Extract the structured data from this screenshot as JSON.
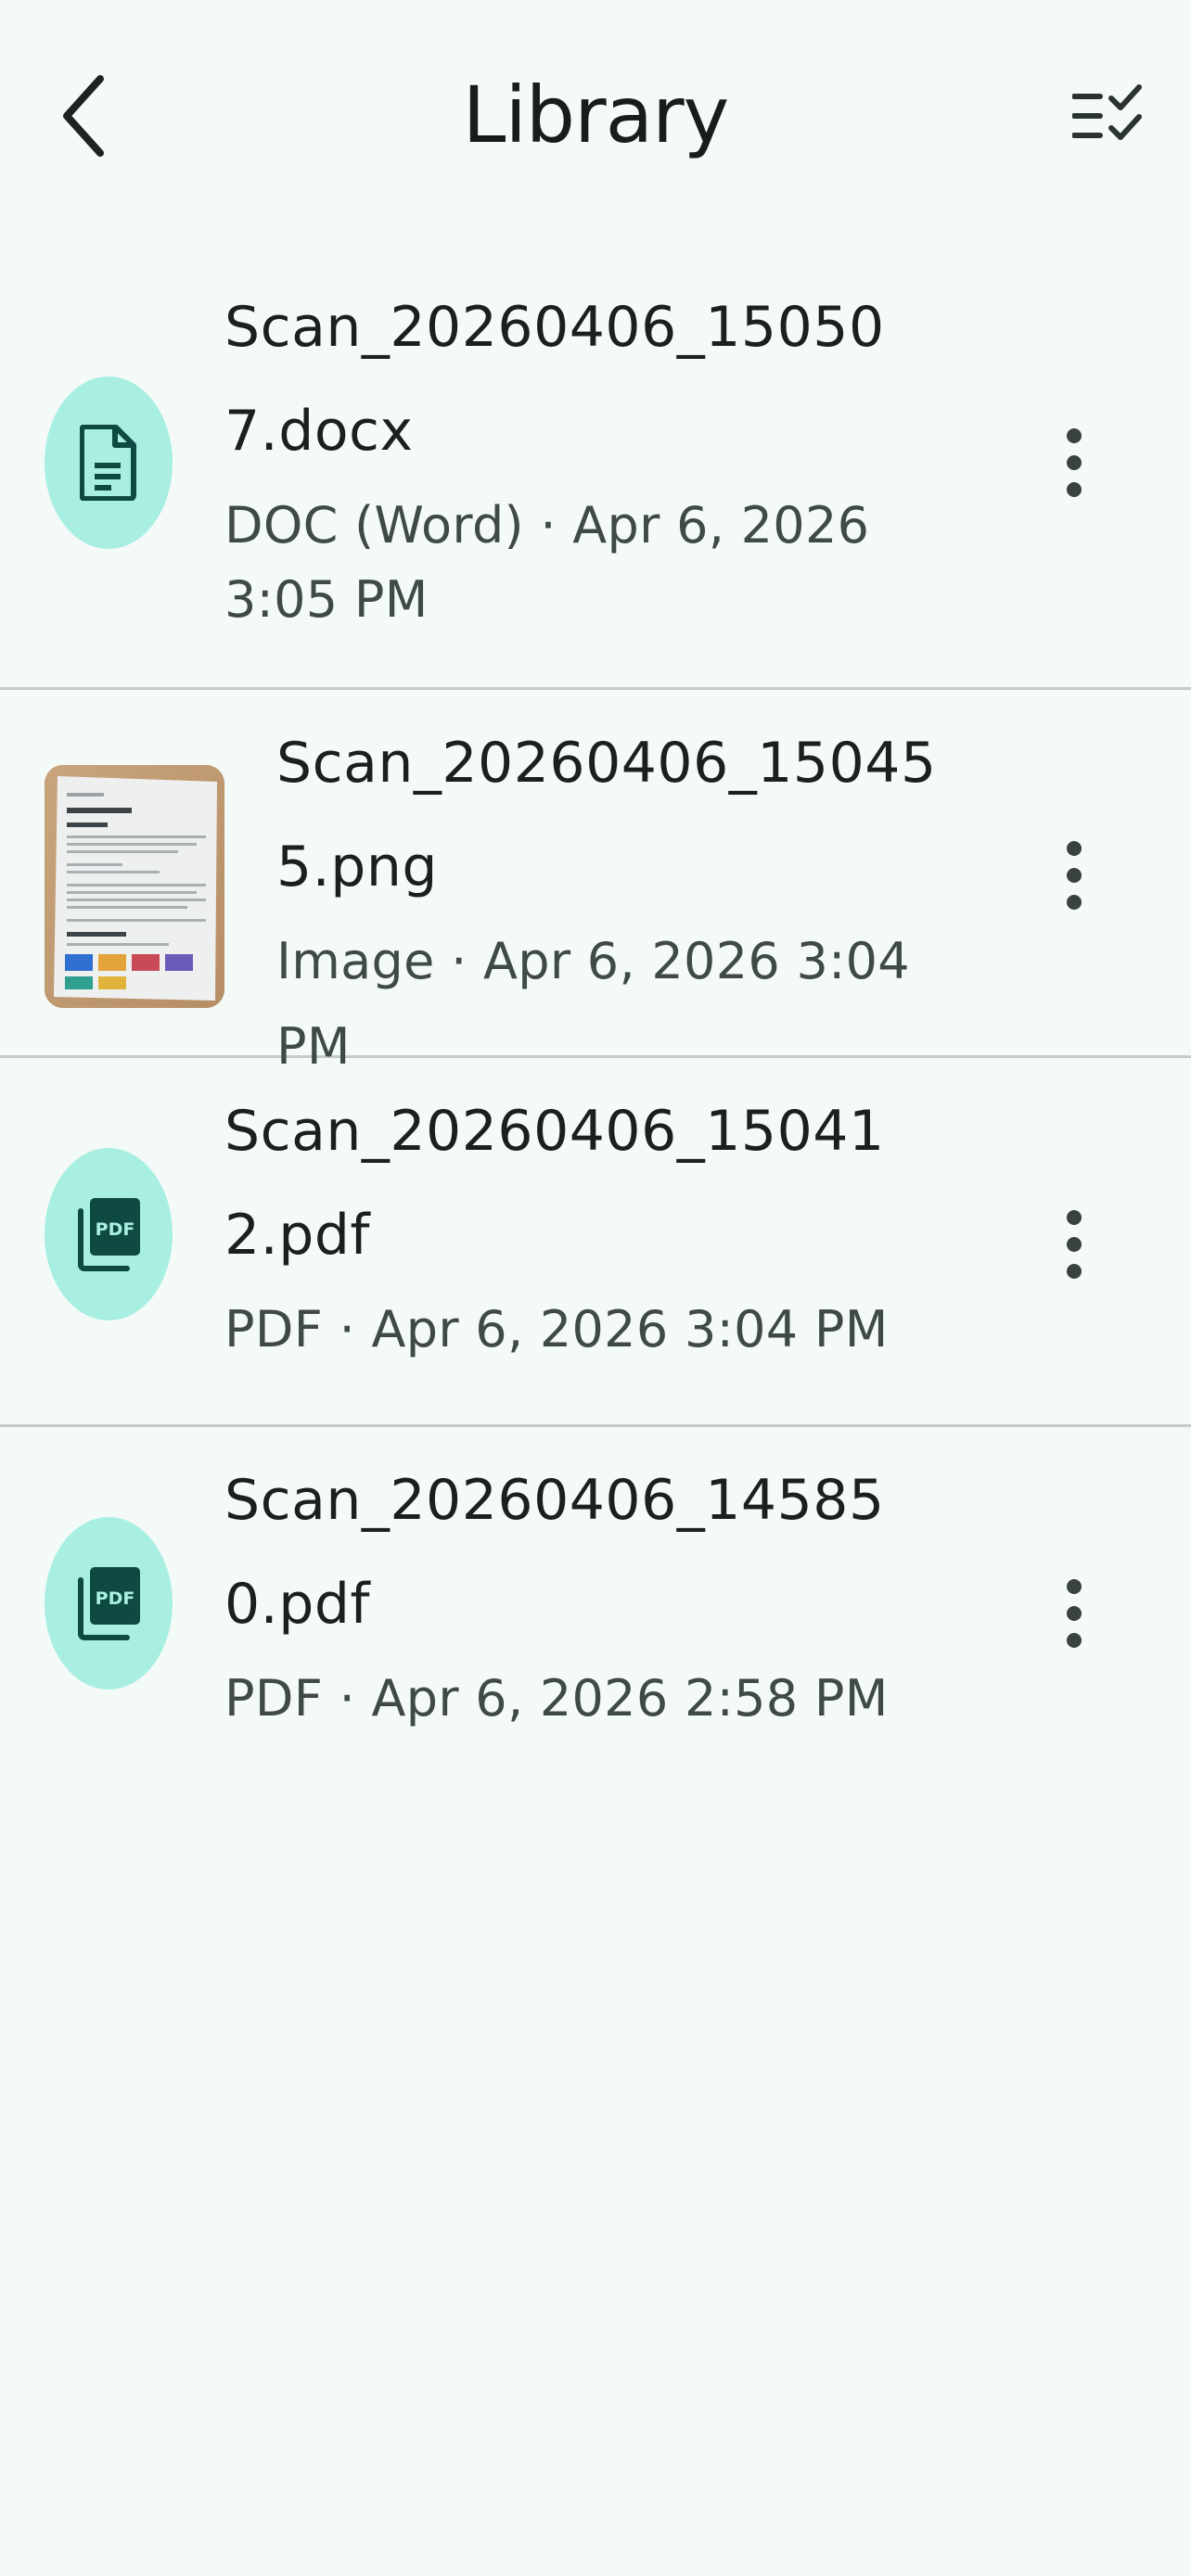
{
  "header": {
    "title": "Library",
    "back_icon": "chevron-left-icon",
    "select_icon": "checklist-icon"
  },
  "files": [
    {
      "name": "Scan_20260406_150507.docx",
      "meta_line1": "DOC (Word) · Apr 6, 2026",
      "meta_line2": "3:05 PM",
      "icon": "document-icon"
    },
    {
      "name": "Scan_20260406_150455.png",
      "meta": "Image · Apr 6, 2026 3:04 PM",
      "icon": "image-thumbnail"
    },
    {
      "name": "Scan_20260406_150412.pdf",
      "meta": "PDF · Apr 6, 2026 3:04 PM",
      "icon": "pdf-icon"
    },
    {
      "name": "Scan_20260406_145850.pdf",
      "meta": "PDF · Apr 6, 2026 2:58 PM",
      "icon": "pdf-icon"
    }
  ],
  "colors": {
    "background": "#f4faf8",
    "icon_bg": "#a8efe2",
    "icon_fg": "#0f4a42",
    "divider": "#c5cbc9"
  }
}
